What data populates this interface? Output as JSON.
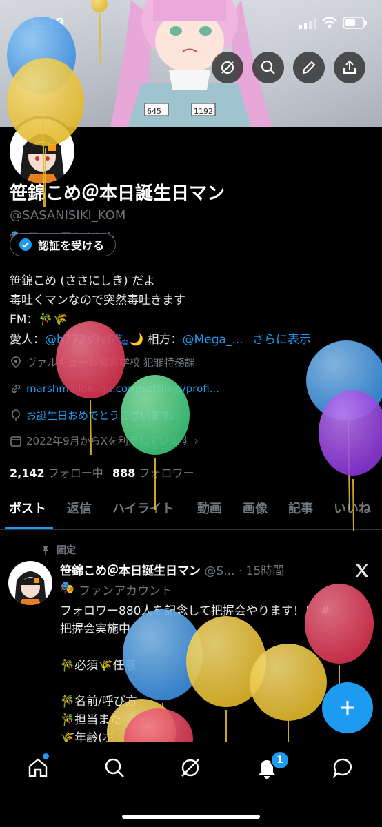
{
  "status_bar": {
    "time": "6:38"
  },
  "banner": {
    "badge_left": "645",
    "badge_right": "1192"
  },
  "profile": {
    "display_name": "笹錦こめ＠本日誕生日マン",
    "handle": "@SASANISIKI_KOM",
    "account_label": "ファンアカウント",
    "verify_button": "認証を受ける",
    "bio_lines": [
      "笹錦こめ (ささにしき) だよ",
      "毒吐くマンなので突然毒吐きます",
      "FM：🎋🌾",
      "愛人："
    ],
    "lover_handle": "@h772s9y6",
    "lover_suffix": "🐾🌙",
    "partner_prefix": "相方：",
    "partner_handle": "@Mega_...",
    "see_more": "さらに表示",
    "location": "ヴァルキューレ警察学校 犯罪特務課",
    "website": "marshmallow-qa.com/settings/profi...",
    "birthday": "お誕生日おめでとうございます。",
    "joined": "2022年9月からXを利用しています",
    "following_count": "2,142",
    "following_label": "フォロー中",
    "followers_count": "888",
    "followers_label": "フォロワー"
  },
  "tabs": [
    "ポスト",
    "返信",
    "ハイライト",
    "動画",
    "画像",
    "記事",
    "いいね"
  ],
  "pinned_post": {
    "pinned_label": "固定",
    "author": "笹錦こめ＠本日誕生日マン",
    "handle": "@S...",
    "time": "· 15時間",
    "account_label": "ファンアカウント",
    "text_line1": "フォロワー880人を記念して把握会やります！！ #",
    "hashtag": "把握会実施中",
    "line_required": "🎋必須🌾任意",
    "line_name": "🎋名前/呼び方",
    "line_charge": "🎋担当また",
    "line_age": "🌾年齢(ボ"
  },
  "bottom_nav": {
    "notification_count": "1"
  },
  "colors": {
    "accent": "#1d9bf0",
    "background": "#000000",
    "muted": "#71767b"
  }
}
